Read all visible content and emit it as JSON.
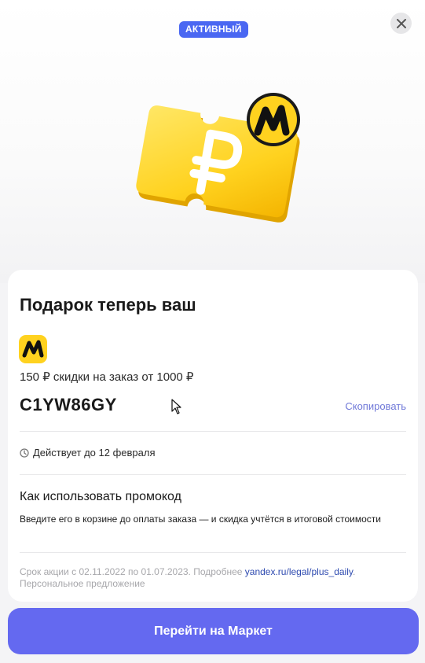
{
  "header": {
    "status_badge": "АКТИВНЫЙ",
    "close_icon": "close-icon"
  },
  "card": {
    "title": "Подарок теперь ваш",
    "offer": "150 ₽ скидки на заказ от 1000 ₽",
    "promo_code": "C1YW86GY",
    "copy_label": "Скопировать",
    "validity": "Действует до 12 февраля",
    "howto_title": "Как использовать промокод",
    "howto_text": "Введите его в корзине до оплаты заказа — и скидка учтётся в итоговой стоимости",
    "terms_prefix": "Срок акции с 02.11.2022 по 01.07.2023. Подробнее ",
    "terms_link": "yandex.ru/legal/plus_daily",
    "terms_suffix": ".",
    "terms_line2": "Персональное предложение"
  },
  "footer": {
    "cta_label": "Перейти на Маркет"
  },
  "colors": {
    "accent": "#6469f0",
    "badge": "#4a67f2",
    "link": "#6f78d8",
    "ticket_yellow": "#ffd83a"
  }
}
